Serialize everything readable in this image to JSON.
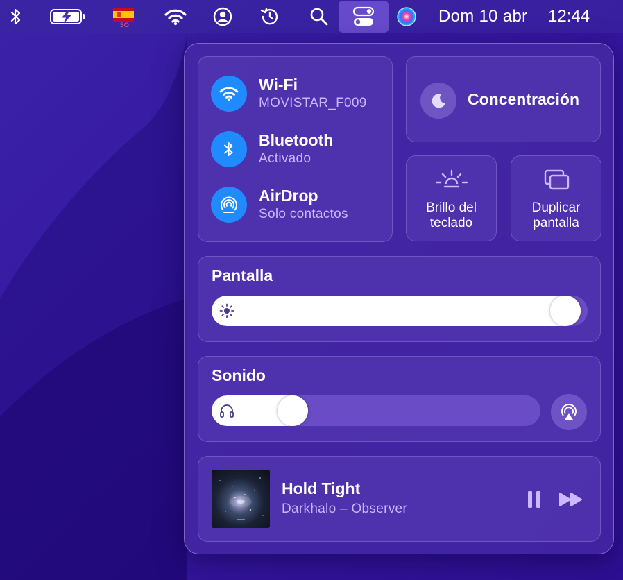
{
  "menubar": {
    "keyboard_flag_sublabel": "ISO",
    "date": "Dom 10 abr",
    "time": "12:44",
    "icons": [
      "bluetooth-icon",
      "battery-charging-icon",
      "spain-flag-icon",
      "wifi-icon",
      "user-icon",
      "time-machine-icon",
      "search-icon",
      "control-center-icon",
      "siri-icon"
    ]
  },
  "control_center": {
    "connectivity": [
      {
        "title": "Wi-Fi",
        "subtitle": "MOVISTAR_F009",
        "icon": "wifi-icon"
      },
      {
        "title": "Bluetooth",
        "subtitle": "Activado",
        "icon": "bluetooth-icon"
      },
      {
        "title": "AirDrop",
        "subtitle": "Solo contactos",
        "icon": "airdrop-icon"
      }
    ],
    "focus": {
      "label": "Concentración",
      "icon": "moon-icon"
    },
    "keyboard_brightness": {
      "label": "Brillo del teclado",
      "icon": "keyboard-brightness-icon"
    },
    "screen_mirroring": {
      "label": "Duplicar pantalla",
      "icon": "screen-mirroring-icon"
    },
    "display": {
      "title": "Pantalla",
      "brightness": 0.98,
      "icon": "sun-icon"
    },
    "sound": {
      "title": "Sonido",
      "volume": 0.22,
      "icon": "headphones-icon",
      "output_icon": "airplay-audio-icon"
    },
    "now_playing": {
      "title": "Hold Tight",
      "subtitle": "Darkhalo – Observer",
      "artwork_icon": "album-artwork",
      "pause_icon": "pause-icon",
      "next_icon": "fast-forward-icon"
    }
  },
  "colors": {
    "accent_blue": "#1f8bff",
    "secondary_text": "#c9b6ff",
    "wallpaper": "#3518a0"
  }
}
